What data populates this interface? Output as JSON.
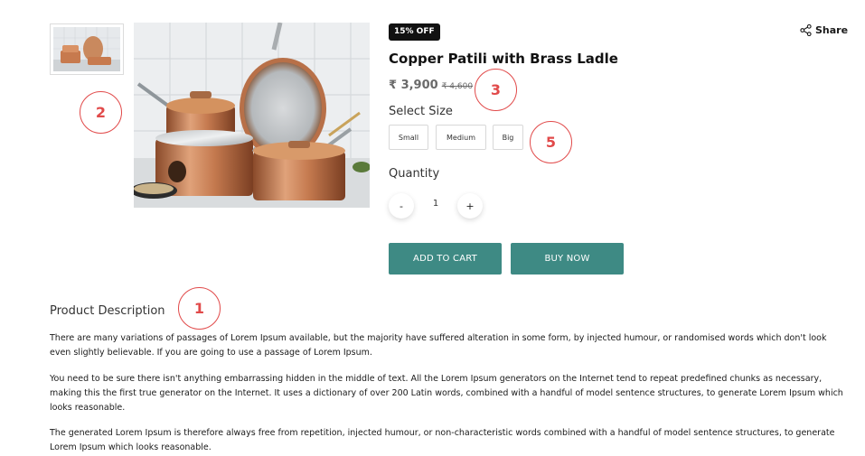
{
  "product": {
    "badge": "15% OFF",
    "share_label": "Share",
    "title": "Copper Patili with Brass Ladle",
    "price": "₹ 3,900",
    "old_price": "₹ 4,600"
  },
  "size": {
    "label": "Select Size",
    "options": [
      "Small",
      "Medium",
      "Big"
    ]
  },
  "quantity": {
    "label": "Quantity",
    "minus": "-",
    "value": "1",
    "plus": "+"
  },
  "actions": {
    "add_to_cart": "ADD TO CART",
    "buy_now": "BUY NOW"
  },
  "description": {
    "title": "Product Description",
    "paragraphs": [
      "There are many variations of passages of Lorem Ipsum available, but the majority have suffered alteration in some form, by injected humour, or randomised words which don't look even slightly believable. If you are going to use a passage of Lorem Ipsum.",
      "You need to be sure there isn't anything embarrassing hidden in the middle of text. All the Lorem Ipsum generators on the Internet tend to repeat predefined chunks as necessary, making this the first true generator on the Internet. It uses a dictionary of over 200 Latin words, combined with a handful of model sentence structures, to generate Lorem Ipsum which looks reasonable.",
      "The generated Lorem Ipsum is therefore always free from repetition, injected humour, or non-characteristic words combined with a handful of model sentence structures, to generate Lorem Ipsum which looks reasonable."
    ]
  },
  "annotations": [
    "1",
    "2",
    "3",
    "5"
  ],
  "colors": {
    "accent": "#3e8a84",
    "annotation": "#e14a4a",
    "badge_bg": "#111111"
  }
}
